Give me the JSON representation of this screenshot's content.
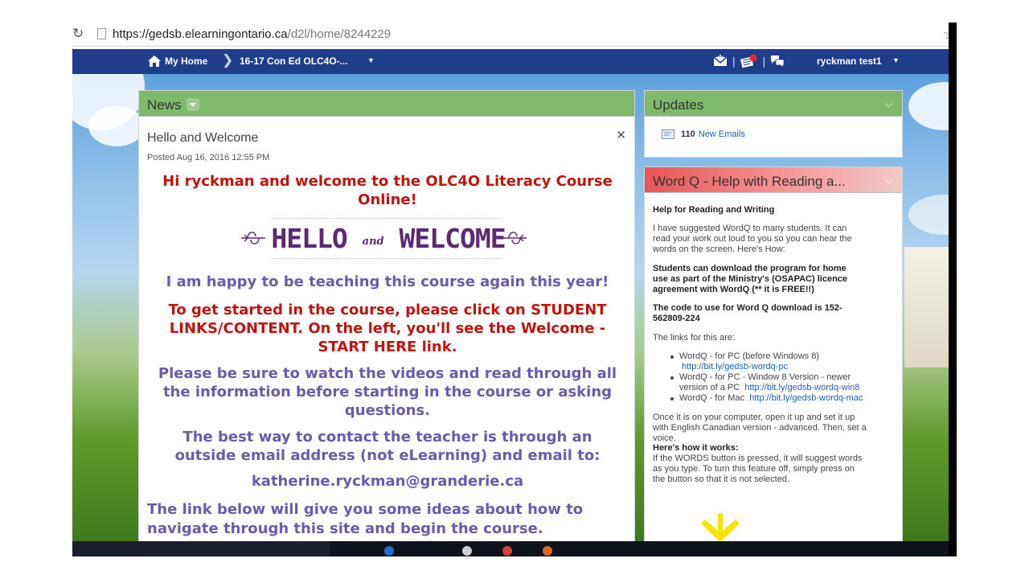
{
  "browser": {
    "url_host": "https://gedsb.elearningontario.ca",
    "url_path": "/d2l/home/8244229"
  },
  "navbar": {
    "home_label": "My Home",
    "course_label": "16-17 Con Ed OLC4O-...",
    "user_label": "ryckman test1",
    "icons": [
      "mail-icon",
      "alerts-icon",
      "chat-icon"
    ],
    "bg_color": "#1f3d8a"
  },
  "news": {
    "header": "News",
    "title": "Hello and Welcome",
    "posted": "Posted Aug 16, 2016 12:55 PM",
    "greeting_line1": "Hi ryckman and welcome to the OLC4O Literacy Course",
    "greeting_line2": "Online!",
    "banner_hello": "HELLO",
    "banner_and": "and",
    "banner_welcome": "WELCOME",
    "happy": "I am happy to be teaching this course again this year!",
    "started_line1": "To get started in the course, please click on STUDENT",
    "started_line2": "LINKS/CONTENT. On the left, you'll see the Welcome -",
    "started_line3": "START HERE link.",
    "videos_line1": "Please be sure to watch the videos and read through all",
    "videos_line2": "the information before starting in the course or asking",
    "videos_line3": "questions.",
    "contact_line1": "The best way to contact the teacher is through an",
    "contact_line2": "outside email address (not eLearning) and email to:",
    "email": "katherine.ryckman@granderie.ca",
    "link_line1": "The link below will give you some ideas about how to",
    "link_line2": "navigate through this site and begin the course.",
    "header_color": "#7fb96a",
    "red_color": "#c0140e",
    "purple_color": "#6a5bab"
  },
  "updates": {
    "header": "Updates",
    "count": "110",
    "link": "New Emails"
  },
  "wordq": {
    "header": "Word Q - Help with Reading a...",
    "heading": "Help for Reading and Writing",
    "p1_l1": "I have suggested WordQ to many students. It can",
    "p1_l2": "read your work out loud to you so you can hear the",
    "p1_l3": "words on the screen.  Here's How:",
    "p2_l1": "Students can download the program for home",
    "p2_l2": "use as part of the Ministry's (OSAPAC) licence",
    "p2_l3": "agreement with WordQ (** it is FREE!!)",
    "p3_l1": "The code to use for Word Q download is 152-",
    "p3_l2": "562809-224",
    "links_intro": "The links for this are:",
    "li1_text": "WordQ - for PC (before Windows 8)",
    "li1_link": "http://bit.ly/gedsb-wordq-pc",
    "li2_text1": "WordQ - for PC - Window 8 Version - newer",
    "li2_text2": "version of a PC",
    "li2_link": "http://bit.ly/gedsb-wordq-win8",
    "li3_text": "WordQ - for Mac",
    "li3_link": "http://bit.ly/gedsb-wordq-mac",
    "p4_l1": "Once it is on your computer, open it up and set it up",
    "p4_l2": "with English Canadian version - advanced. Then, set a",
    "p4_l3": "voice.",
    "how_heading": "Here's how it works:",
    "p5_l1": "If the WORDS button is pressed, it will suggest words",
    "p5_l2": "as you type.  To turn this feature off, simply press on",
    "p5_l3": "the button so that it is not selected.",
    "arrow_color": "#f6e500"
  }
}
